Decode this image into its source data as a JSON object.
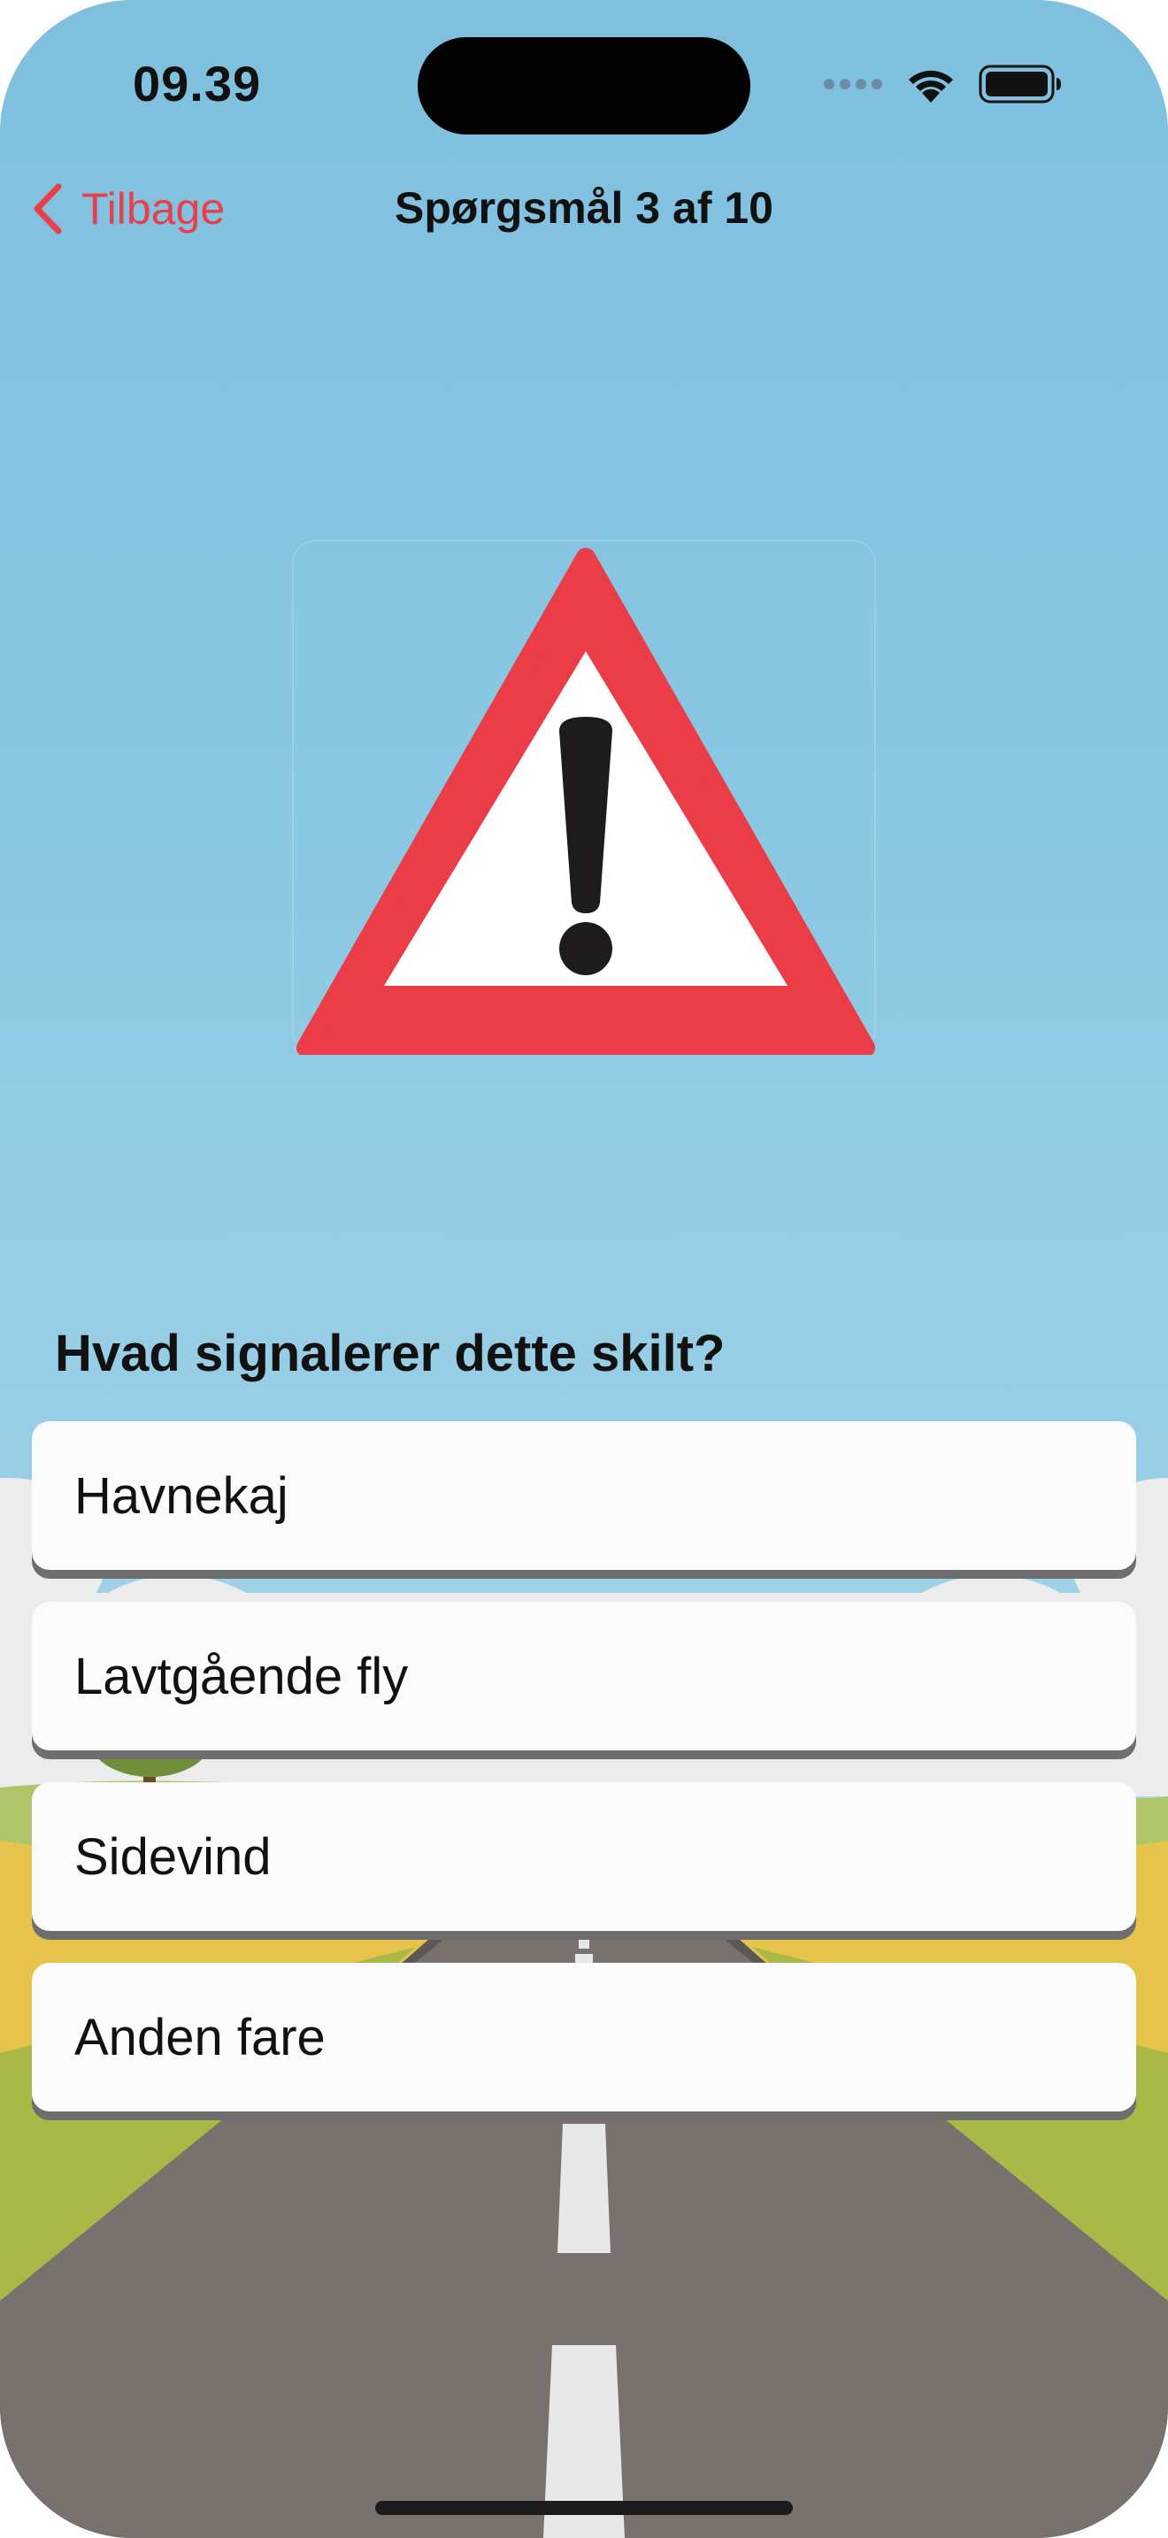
{
  "status_bar": {
    "time": "09.39",
    "icons": [
      "cellular-dots-icon",
      "wifi-icon",
      "battery-icon"
    ]
  },
  "nav": {
    "back_label": "Tilbage",
    "title": "Spørgsmål 3 af 10",
    "accent_color": "#e8404a"
  },
  "sign": {
    "icon": "warning-triangle-exclamation-icon",
    "border_color": "#ea3d48"
  },
  "quiz": {
    "question": "Hvad signalerer dette skilt?",
    "answers": [
      {
        "label": "Havnekaj"
      },
      {
        "label": "Lavtgående fly"
      },
      {
        "label": "Sidevind"
      },
      {
        "label": "Anden fare"
      }
    ]
  },
  "background": {
    "sky_color": "#81c2e0",
    "road_color": "#79716d"
  }
}
